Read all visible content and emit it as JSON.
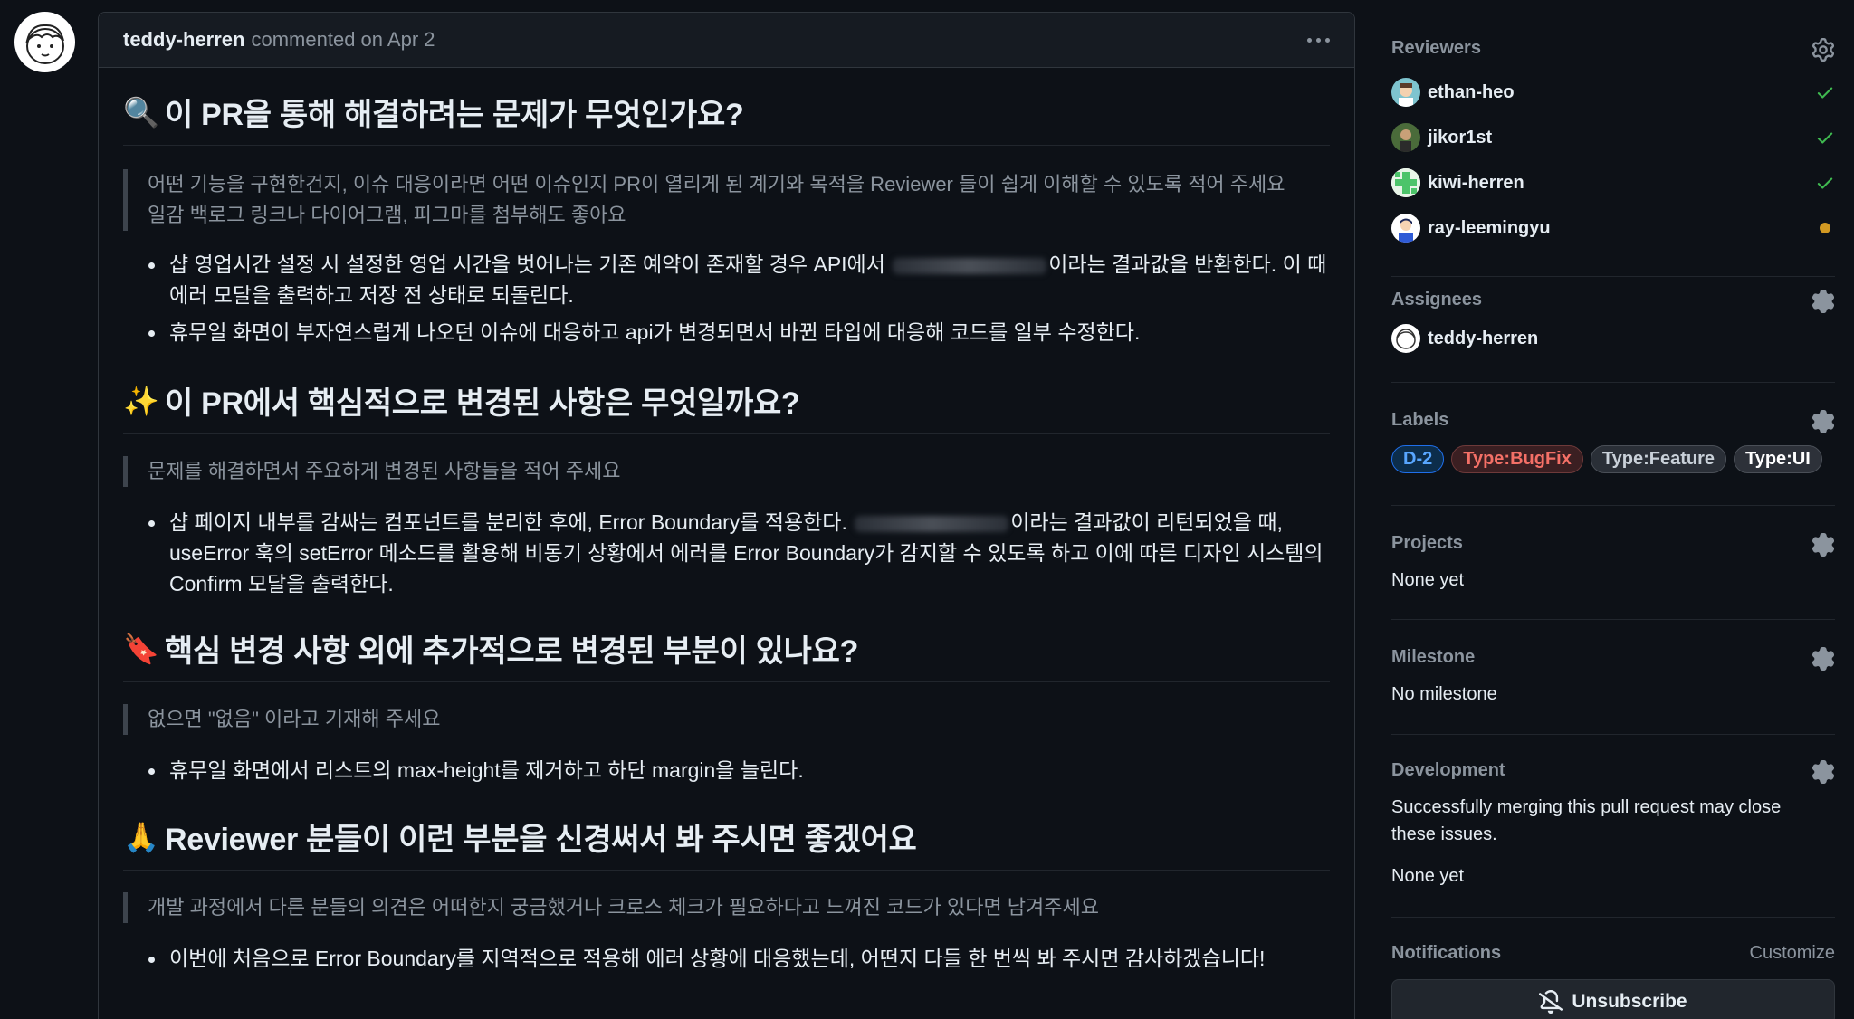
{
  "comment": {
    "author": "teddy-herren",
    "meta": "commented on Apr 2",
    "sections": [
      {
        "emoji": "🔍",
        "title": "이 PR을 통해 해결하려는 문제가 무엇인가요?",
        "quote": [
          "어떤 기능을 구현한건지, 이슈 대응이라면 어떤 이슈인지 PR이 열리게 된 계기와 목적을 Reviewer 들이 쉽게 이해할 수 있도록 적어 주세요",
          "일감 백로그 링크나 다이어그램, 피그마를 첨부해도 좋아요"
        ],
        "items": [
          {
            "before": "샵 영업시간 설정 시 설정한 영업 시간을 벗어나는 기존 예약이 존재할 경우 API에서 ",
            "after": "이라는 결과값을 반환한다. 이 때 에러 모달을 출력하고 저장 전 상태로 되돌린다."
          },
          {
            "before": "휴무일 화면이 부자연스럽게 나오던 이슈에 대응하고 api가 변경되면서 바뀐 타입에 대응해 코드를 일부 수정한다.",
            "after": ""
          }
        ]
      },
      {
        "emoji": "✨",
        "title": "이 PR에서 핵심적으로 변경된 사항은 무엇일까요?",
        "quote": [
          "문제를 해결하면서 주요하게 변경된 사항들을 적어 주세요"
        ],
        "items": [
          {
            "before": "샵 페이지 내부를 감싸는 컴포넌트를 분리한 후에, Error Boundary를 적용한다. ",
            "after": "이라는 결과값이 리턴되었을 때, useError 훅의 setError 메소드를 활용해 비동기 상황에서 에러를 Error Boundary가 감지할 수 있도록 하고 이에 따른 디자인 시스템의 Confirm 모달을 출력한다."
          }
        ]
      },
      {
        "emoji": "🔖",
        "title": "핵심 변경 사항 외에 추가적으로 변경된 부분이 있나요?",
        "quote": [
          "없으면 \"없음\" 이라고 기재해 주세요"
        ],
        "items": [
          {
            "before": "휴무일 화면에서 리스트의 max-height를 제거하고 하단 margin을 늘린다.",
            "after": ""
          }
        ]
      },
      {
        "emoji": "🙏",
        "title": "Reviewer 분들이 이런 부분을 신경써서 봐 주시면 좋겠어요",
        "quote": [
          "개발 과정에서 다른 분들의 의견은 어떠한지 궁금했거나 크로스 체크가 필요하다고 느껴진 코드가 있다면 남겨주세요"
        ],
        "items": [
          {
            "before": "이번에 처음으로 Error Boundary를 지역적으로 적용해 에러 상황에 대응했는데, 어떤지 다들 한 번씩 봐 주시면 감사하겠습니다!",
            "after": ""
          }
        ]
      }
    ]
  },
  "sidebar": {
    "reviewers": {
      "title": "Reviewers",
      "people": [
        {
          "name": "ethan-heo",
          "status": "approved"
        },
        {
          "name": "jikor1st",
          "status": "approved"
        },
        {
          "name": "kiwi-herren",
          "status": "approved"
        },
        {
          "name": "ray-leemingyu",
          "status": "pending"
        }
      ]
    },
    "assignees": {
      "title": "Assignees",
      "people": [
        {
          "name": "teddy-herren"
        }
      ]
    },
    "labels": {
      "title": "Labels",
      "items": [
        {
          "name": "D-2",
          "color": "#58a6ff"
        },
        {
          "name": "Type:BugFix",
          "color": "#f47067"
        },
        {
          "name": "Type:Feature",
          "color": "#c9d1d9"
        },
        {
          "name": "Type:UI",
          "color": "#ffffff"
        }
      ]
    },
    "projects": {
      "title": "Projects",
      "value": "None yet"
    },
    "milestone": {
      "title": "Milestone",
      "value": "No milestone"
    },
    "development": {
      "title": "Development",
      "description": "Successfully merging this pull request may close these issues.",
      "value": "None yet"
    },
    "notifications": {
      "title": "Notifications",
      "customize": "Customize",
      "unsubscribe": "Unsubscribe"
    }
  },
  "colors": {
    "approved": "#3fb950",
    "pending": "#d29922",
    "background": "#0d1117"
  }
}
